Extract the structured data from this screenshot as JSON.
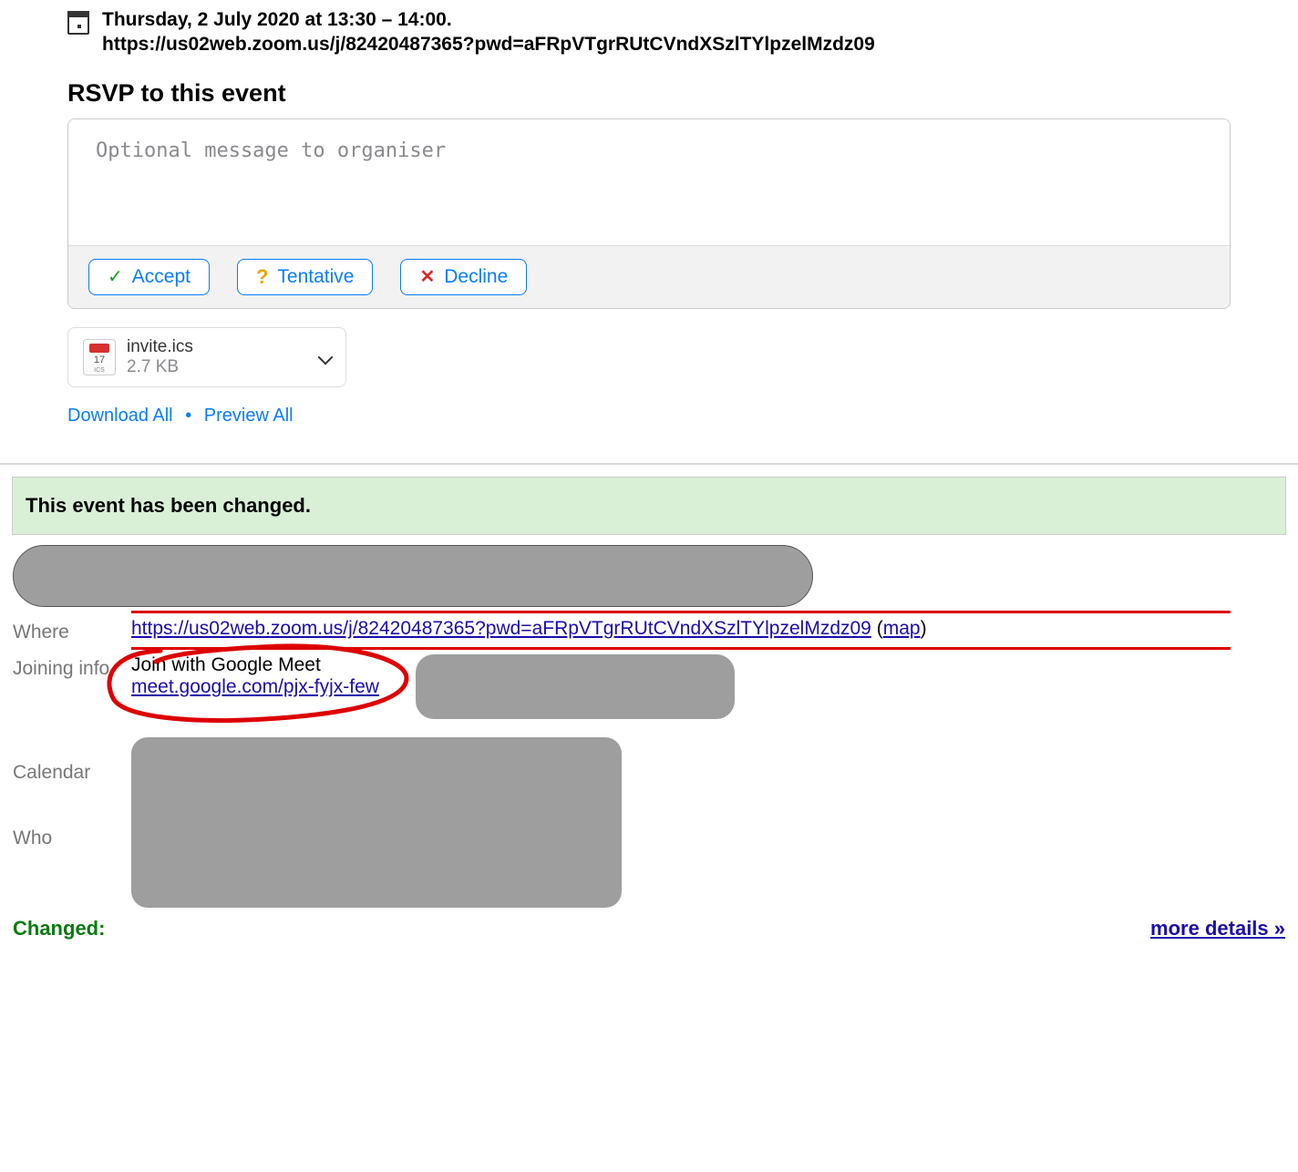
{
  "event": {
    "datetime_line": "Thursday, 2 July 2020 at 13:30 – 14:00.",
    "zoom_url": "https://us02web.zoom.us/j/82420487365?pwd=aFRpVTgrRUtCVndXSzlTYlpzelMzdz09"
  },
  "rsvp": {
    "title": "RSVP to this event",
    "placeholder": "Optional message to organiser",
    "accept_label": "Accept",
    "tentative_label": "Tentative",
    "decline_label": "Decline"
  },
  "attachment": {
    "filename": "invite.ics",
    "size": "2.7 KB",
    "ics_sub": "ICS",
    "download_all": "Download All",
    "preview_all": "Preview All",
    "sep": "•"
  },
  "banner": {
    "changed": "This event has been changed."
  },
  "details": {
    "labels": {
      "where": "Where",
      "joining_info": "Joining info",
      "calendar": "Calendar",
      "who": "Who",
      "changed": "Changed:"
    },
    "where_url": "https://us02web.zoom.us/j/82420487365?pwd=aFRpVTgrRUtCVndXSzlTYlpzelMzdz09",
    "map_label": "map",
    "join_title": "Join with Google Meet",
    "meet_url": "meet.google.com/pjx-fyjx-few",
    "more_details": "more details »"
  }
}
